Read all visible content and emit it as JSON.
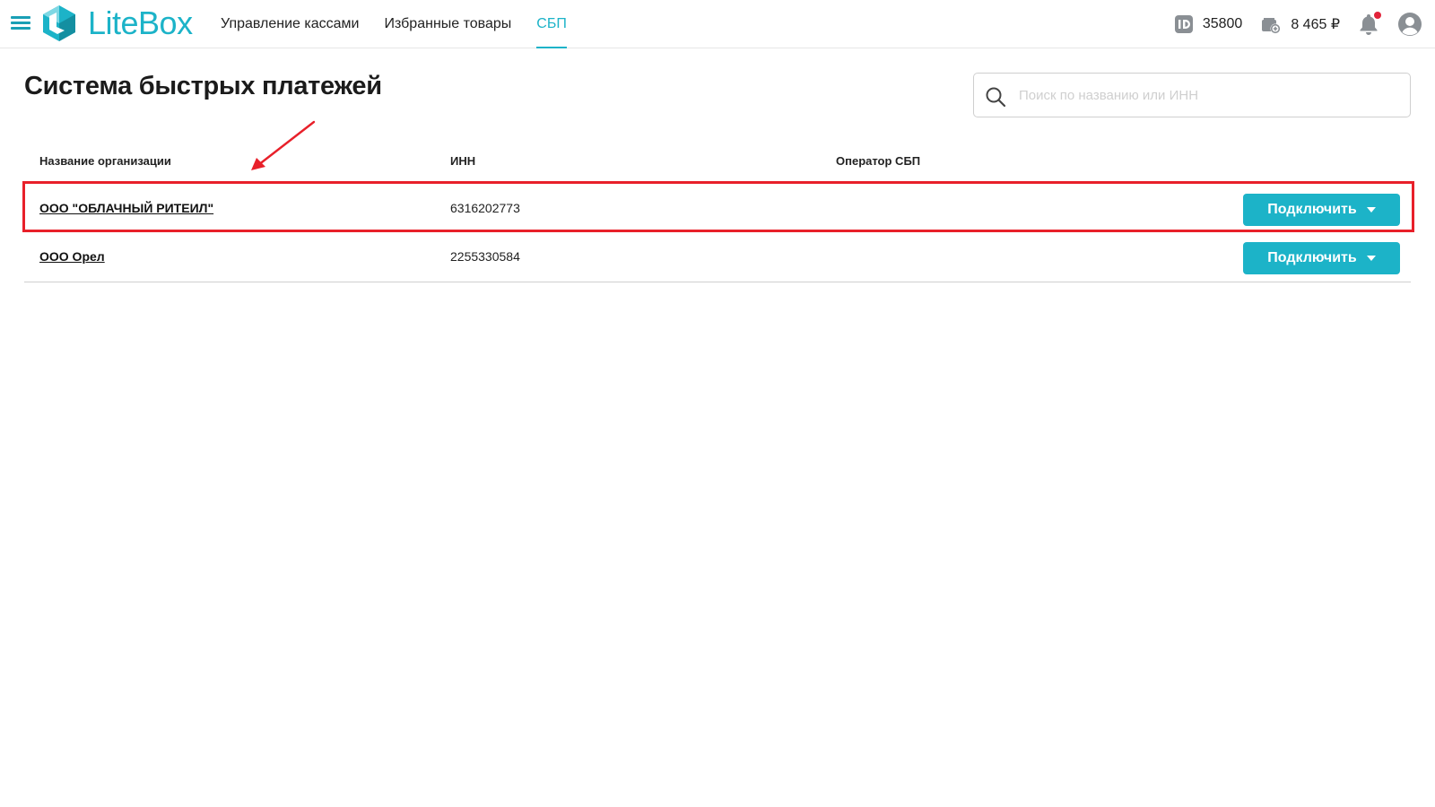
{
  "app": {
    "brand": "LiteBox",
    "accent_color": "#1cb3c8",
    "logo_icon": "litebox-logo-icon"
  },
  "nav": {
    "items": [
      {
        "label": "Управление кассами",
        "active": false
      },
      {
        "label": "Избранные товары",
        "active": false
      },
      {
        "label": "СБП",
        "active": true
      }
    ]
  },
  "header_tools": {
    "id_icon": "id-badge-icon",
    "id_value": "35800",
    "balance_icon": "wallet-icon",
    "balance_value": "8 465 ₽",
    "notification_icon": "bell-icon",
    "has_unread": true,
    "profile_icon": "user-avatar-icon"
  },
  "page": {
    "title": "Система быстрых платежей"
  },
  "search": {
    "placeholder": "Поиск по названию или ИНН",
    "value": ""
  },
  "table": {
    "columns": [
      "Название организации",
      "ИНН",
      "Оператор СБП"
    ],
    "rows": [
      {
        "name": "ООО \"ОБЛАЧНЫЙ РИТЕИЛ\"",
        "inn": "6316202773",
        "operator": "",
        "action": "Подключить",
        "highlighted": true
      },
      {
        "name": "ООО Орел",
        "inn": "2255330584",
        "operator": "",
        "action": "Подключить",
        "highlighted": false
      }
    ]
  },
  "annotation": {
    "highlight_color": "#e8202a"
  }
}
